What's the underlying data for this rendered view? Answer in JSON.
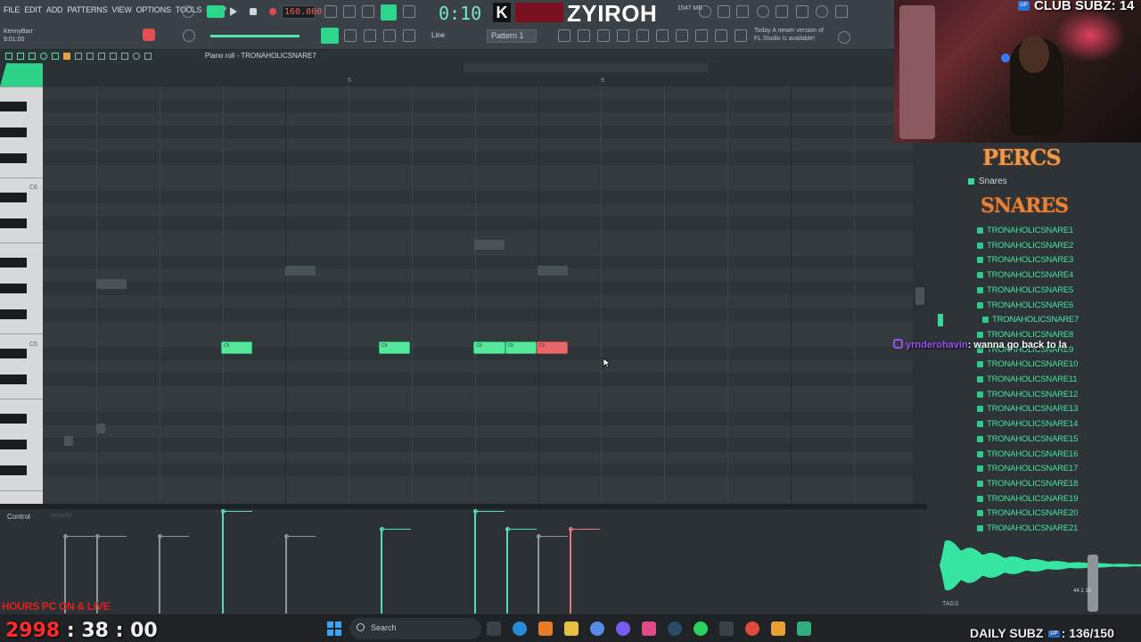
{
  "menu": [
    "FILE",
    "EDIT",
    "ADD",
    "PATTERNS",
    "VIEW",
    "OPTIONS",
    "TOOLS",
    "HELP"
  ],
  "toolbar": {
    "user": "KennyBarr",
    "user_time": "9:01:00",
    "tempo": "160.000",
    "time": "0:10",
    "streamer_name": "ZYIROH",
    "memory": "1547 MB",
    "pattern": "Pattern 1",
    "snap_mode": "Line",
    "news_line1": "Today  A newer version of",
    "news_line2": "FL Studio is available!"
  },
  "piano_roll": {
    "title": "Piano roll - TRONAHOLICSNARE7",
    "bar_numbers": [
      "5",
      "9"
    ],
    "key_labels": [
      "C6",
      "C5"
    ],
    "notes": [
      {
        "label": "C5",
        "color": "green",
        "start": 4.0,
        "length": 0.5
      },
      {
        "label": "C5",
        "color": "green",
        "start": 6.5,
        "length": 0.5
      },
      {
        "label": "C5",
        "color": "green",
        "start": 8.0,
        "length": 0.5
      },
      {
        "label": "C5",
        "color": "green",
        "start": 8.5,
        "length": 0.5
      },
      {
        "label": "C5",
        "color": "red",
        "start": 9.0,
        "length": 0.5
      }
    ]
  },
  "control": {
    "label": "Control",
    "sub_label": "Velocity"
  },
  "browser": {
    "perc_header": "PERCS",
    "folder": "Snares",
    "snares_header": "SNARES",
    "files": [
      "TRONAHOLICSNARE1",
      "TRONAHOLICSNARE2",
      "TRONAHOLICSNARE3",
      "TRONAHOLICSNARE4",
      "TRONAHOLICSNARE5",
      "TRONAHOLICSNARE6",
      "TRONAHOLICSNARE7",
      "TRONAHOLICSNARE8",
      "TRONAHOLICSNARE9",
      "TRONAHOLICSNARE10",
      "TRONAHOLICSNARE11",
      "TRONAHOLICSNARE12",
      "TRONAHOLICSNARE13",
      "TRONAHOLICSNARE14",
      "TRONAHOLICSNARE15",
      "TRONAHOLICSNARE16",
      "TRONAHOLICSNARE17",
      "TRONAHOLICSNARE18",
      "TRONAHOLICSNARE19",
      "TRONAHOLICSNARE20",
      "TRONAHOLICSNARE21"
    ],
    "selected_index": 6,
    "tags_label": "TAGS",
    "wave_info": "44.1 16"
  },
  "overlay": {
    "club_subz": "CLUB SUBZ: 14",
    "chat_user": "yrnderohavin",
    "chat_message": ": wanna go back to la",
    "hours_text": "HOURS PC ON & LIVE",
    "counter_prefix": "2998",
    "counter_rest": " : 38 : 00",
    "daily_subz_label": "DAILY SUBZ",
    "daily_subz_value": ": 136/150",
    "up_badge": "UP"
  },
  "taskbar": {
    "search_placeholder": "Search"
  },
  "colors": {
    "accent_green": "#2cd68c",
    "note_green": "#55e89c",
    "note_red": "#e8686a",
    "file_green": "#46e39f"
  }
}
